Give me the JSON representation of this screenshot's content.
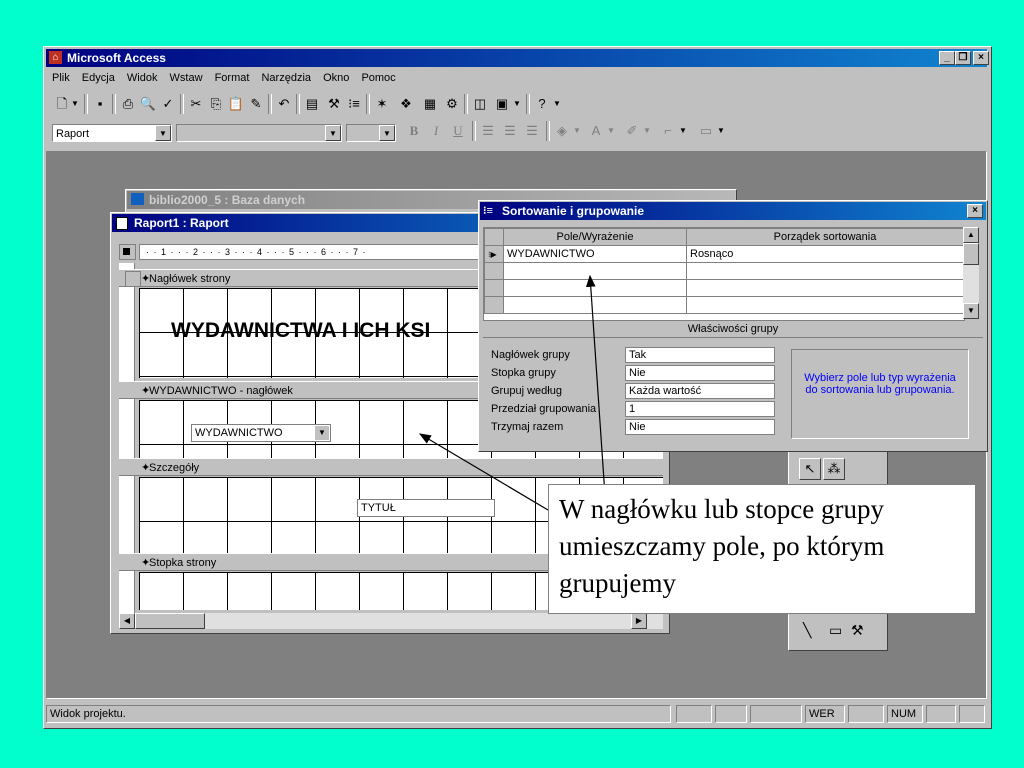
{
  "app": {
    "title": "Microsoft Access"
  },
  "menu": [
    "Plik",
    "Edycja",
    "Widok",
    "Wstaw",
    "Format",
    "Narzędzia",
    "Okno",
    "Pomoc"
  ],
  "format_toolbar": {
    "object_combo": "Raport",
    "bold": "B",
    "italic": "I",
    "underline": "U"
  },
  "db_window": {
    "title": "biblio2000_5 : Baza danych"
  },
  "report_window": {
    "title": "Raport1 : Raport",
    "ruler": "· · 1 · · · 2 · · · 3 · · · 4 · · · 5 · · · 6 · · · 7 ·",
    "sections": {
      "page_header": "Nagłówek strony",
      "group_header": "WYDAWNICTWO - nagłówek",
      "detail": "Szczegóły",
      "page_footer": "Stopka strony"
    },
    "title_label": "WYDAWNICTWA I ICH KSI",
    "group_field": "WYDAWNICTWO",
    "detail_field": "TYTUŁ",
    "vruler_mark": "1"
  },
  "sort_dialog": {
    "title": "Sortowanie i grupowanie",
    "columns": [
      "Pole/Wyrażenie",
      "Porządek sortowania"
    ],
    "rows": [
      {
        "field": "WYDAWNICTWO",
        "order": "Rosnąco"
      }
    ],
    "group_props_title": "Właściwości grupy",
    "props": [
      {
        "label": "Nagłówek grupy",
        "value": "Tak"
      },
      {
        "label": "Stopka grupy",
        "value": "Nie"
      },
      {
        "label": "Grupuj według",
        "value": "Każda wartość"
      },
      {
        "label": "Przedział grupowania",
        "value": "1"
      },
      {
        "label": "Trzymaj razem",
        "value": "Nie"
      }
    ],
    "hint": "Wybierz pole lub typ wyrażenia do sortowania lub grupowania."
  },
  "annotation": {
    "text": "W nagłówku lub stopce grupy umieszczamy pole, po którym grupujemy"
  },
  "status": {
    "text": "Widok projektu.",
    "wer": "WER",
    "num": "NUM"
  },
  "colors": {
    "background": "#00ffcc",
    "titlebar": "#000080",
    "hint_text": "#0000ff"
  }
}
